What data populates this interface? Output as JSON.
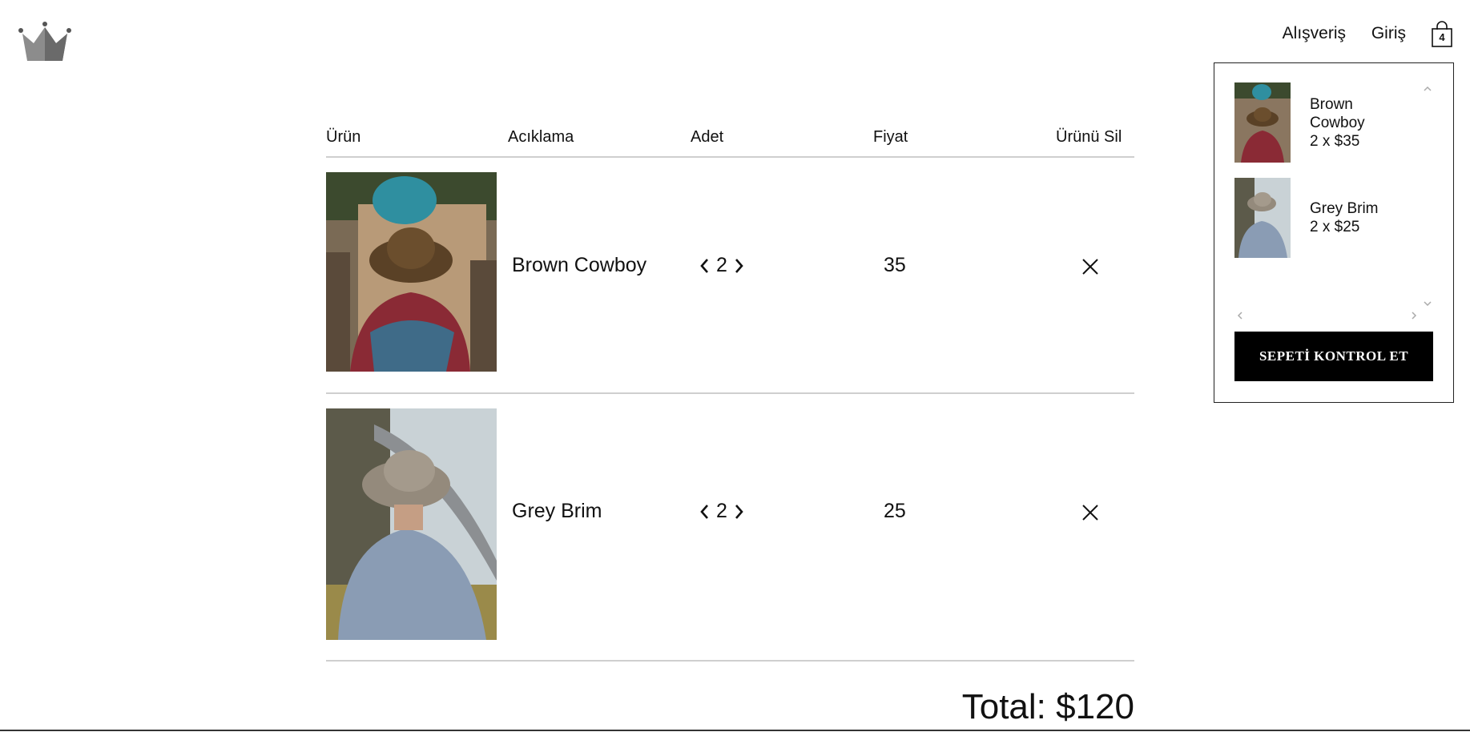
{
  "nav": {
    "shop_label": "Alışveriş",
    "login_label": "Giriş",
    "cart_count": "4"
  },
  "table": {
    "headers": [
      "Ürün",
      "Acıklama",
      "Adet",
      "Fiyat",
      "Ürünü Sil"
    ],
    "rows": [
      {
        "name": "Brown Cowboy",
        "qty": "2",
        "price": "35"
      },
      {
        "name": "Grey Brim",
        "qty": "2",
        "price": "25"
      }
    ]
  },
  "total": "Total: $120",
  "mini_cart": {
    "items": [
      {
        "name": "Brown Cowboy",
        "summary": "2 x $35"
      },
      {
        "name": "Grey Brim",
        "summary": "2 x $25"
      }
    ],
    "checkout_label": "SEPETİ KONTROL ET"
  },
  "icons": {
    "logo": "crown-logo",
    "cart": "shopping-bag-icon",
    "remove": "close-icon",
    "qty_decrease": "chevron-left-icon",
    "qty_increase": "chevron-right-icon"
  }
}
